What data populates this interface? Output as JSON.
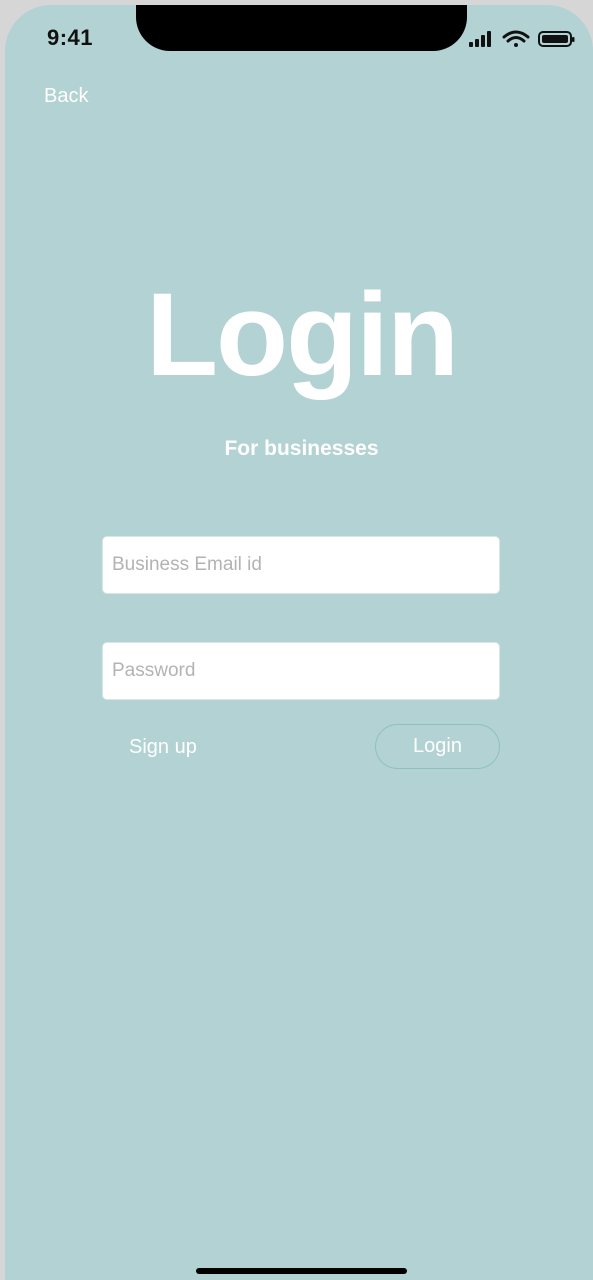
{
  "status_bar": {
    "time": "9:41",
    "icons": [
      "signal-icon",
      "wifi-icon",
      "battery-icon"
    ]
  },
  "nav": {
    "back_label": "Back"
  },
  "header": {
    "title": "Login",
    "subtitle": "For businesses"
  },
  "form": {
    "email_placeholder": "Business Email id",
    "email_value": "",
    "password_placeholder": "Password",
    "password_value": "",
    "signup_label": "Sign up",
    "login_label": "Login"
  },
  "colors": {
    "background": "#b3d2d3",
    "text": "#ffffff",
    "button_border": "#8fc1c2"
  }
}
